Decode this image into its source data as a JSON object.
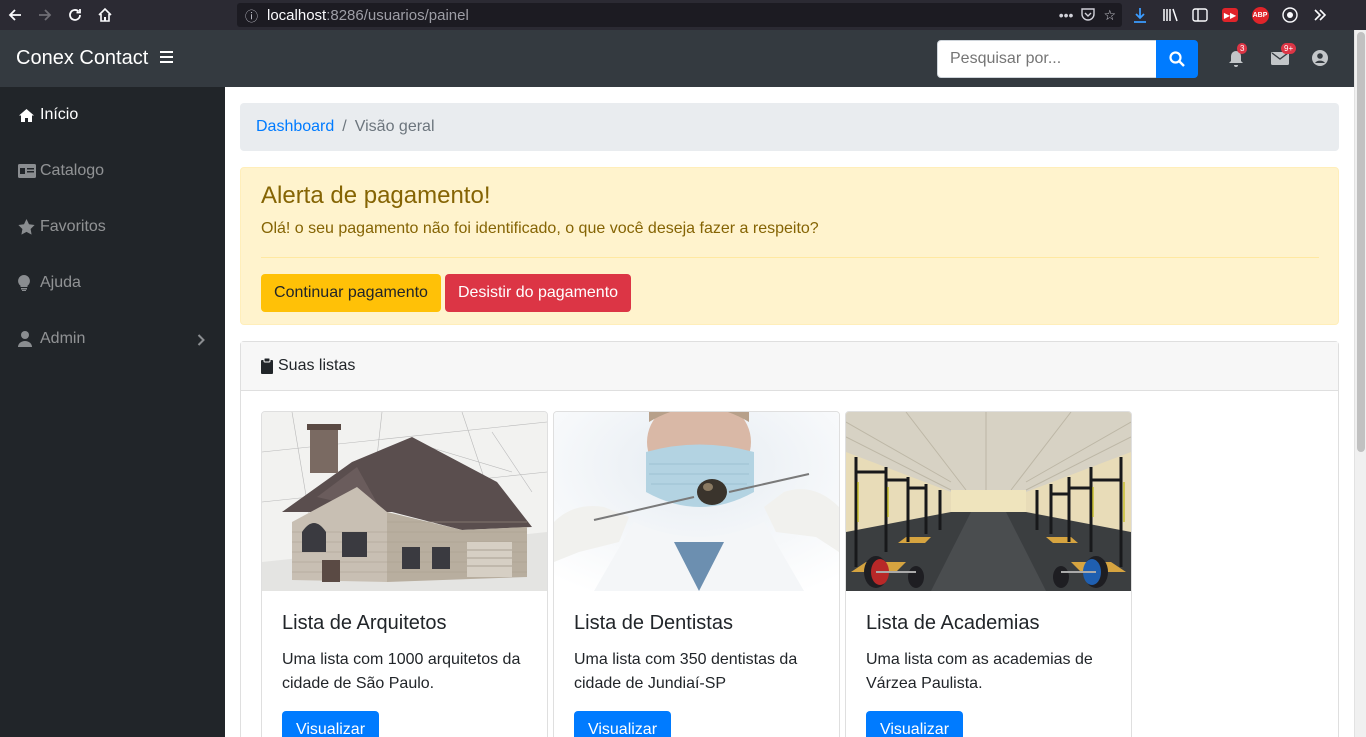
{
  "browser": {
    "url_host": "localhost",
    "url_rest": ":8286/usuarios/painel"
  },
  "navbar": {
    "brand": "Conex Contact",
    "search_placeholder": "Pesquisar por...",
    "notifications_badge": "3",
    "messages_badge": "9+"
  },
  "sidebar": {
    "items": [
      {
        "label": "Início",
        "icon": "home-icon"
      },
      {
        "label": "Catalogo",
        "icon": "id-card-icon"
      },
      {
        "label": "Favoritos",
        "icon": "star-icon"
      },
      {
        "label": "Ajuda",
        "icon": "lightbulb-icon"
      },
      {
        "label": "Admin",
        "icon": "user-icon"
      }
    ]
  },
  "breadcrumb": {
    "link": "Dashboard",
    "current": "Visão geral"
  },
  "alert": {
    "title": "Alerta de pagamento!",
    "text": "Olá! o seu pagamento não foi identificado, o que você deseja fazer a respeito?",
    "continue_label": "Continuar pagamento",
    "cancel_label": "Desistir do pagamento"
  },
  "lists": {
    "header": "Suas listas",
    "cards": [
      {
        "title": "Lista de Arquitetos",
        "text": "Uma lista com 1000 arquitetos da cidade de São Paulo.",
        "button": "Visualizar"
      },
      {
        "title": "Lista de Dentistas",
        "text": "Uma lista com 350 dentistas da cidade de Jundiaí-SP",
        "button": "Visualizar"
      },
      {
        "title": "Lista de Academias",
        "text": "Uma lista com as academias de Várzea Paulista.",
        "button": "Visualizar"
      }
    ]
  },
  "colors": {
    "primary": "#007bff",
    "warning": "#ffc107",
    "danger": "#dc3545",
    "sidebar": "#212529",
    "navbar": "#343a40"
  }
}
